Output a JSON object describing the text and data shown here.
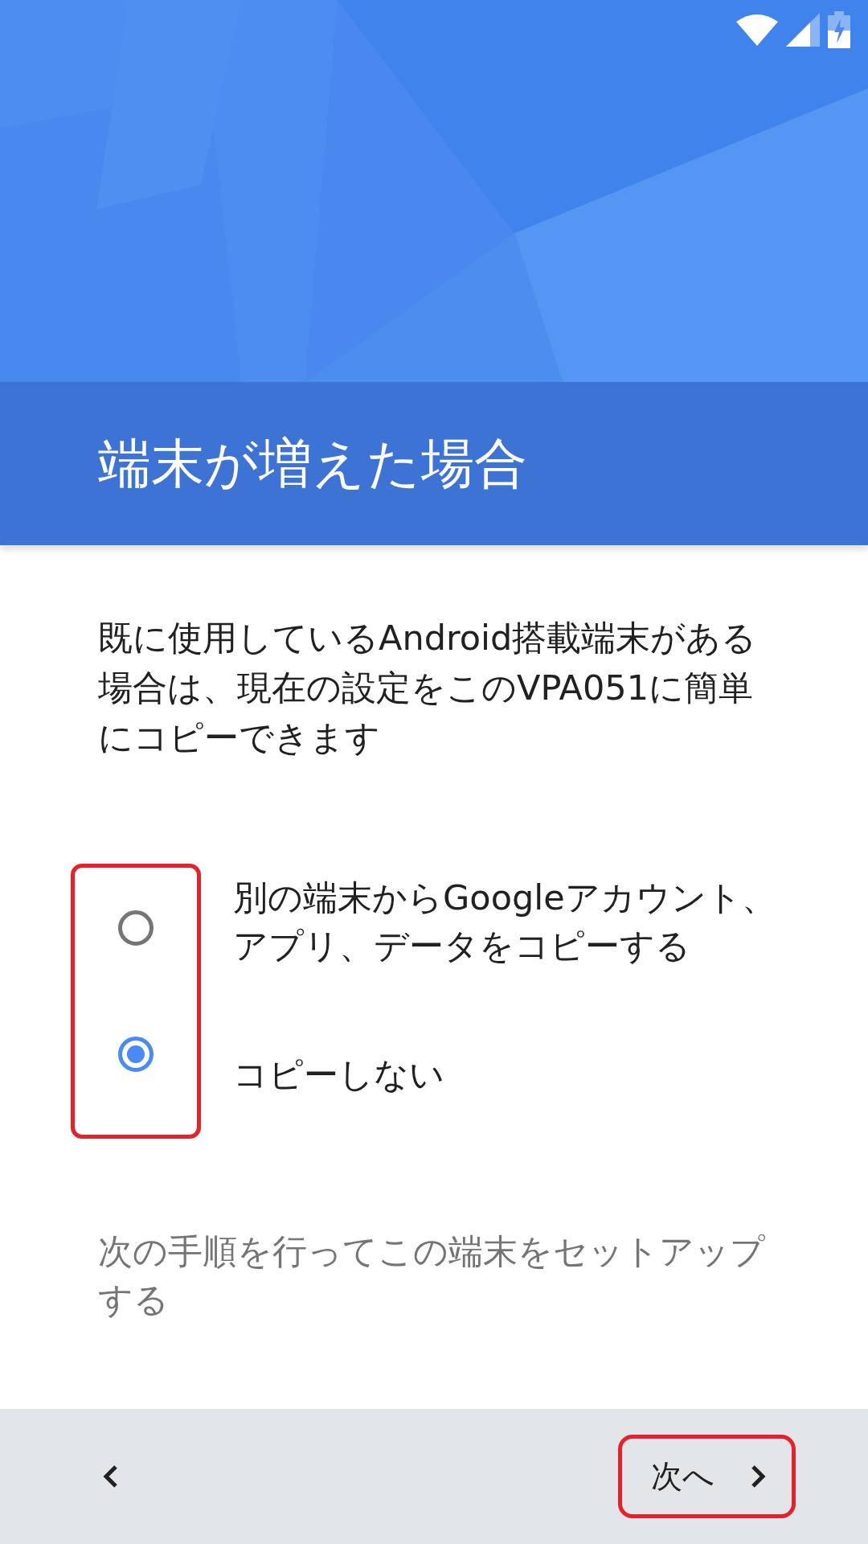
{
  "header": {
    "title": "端末が増えた場合"
  },
  "description": "既に使用しているAndroid搭載端末がある場合は、現在の設定をこのVPA051に簡単にコピーできます",
  "options_highlighted": true,
  "options": [
    {
      "label": "別の端末からGoogleアカウント、アプリ、データをコピーする",
      "selected": false
    },
    {
      "label": "コピーしない",
      "selected": true
    }
  ],
  "footer_text": "次の手順を行ってこの端末をセットアップする",
  "nav": {
    "next_label": "次へ",
    "next_highlighted": true
  }
}
